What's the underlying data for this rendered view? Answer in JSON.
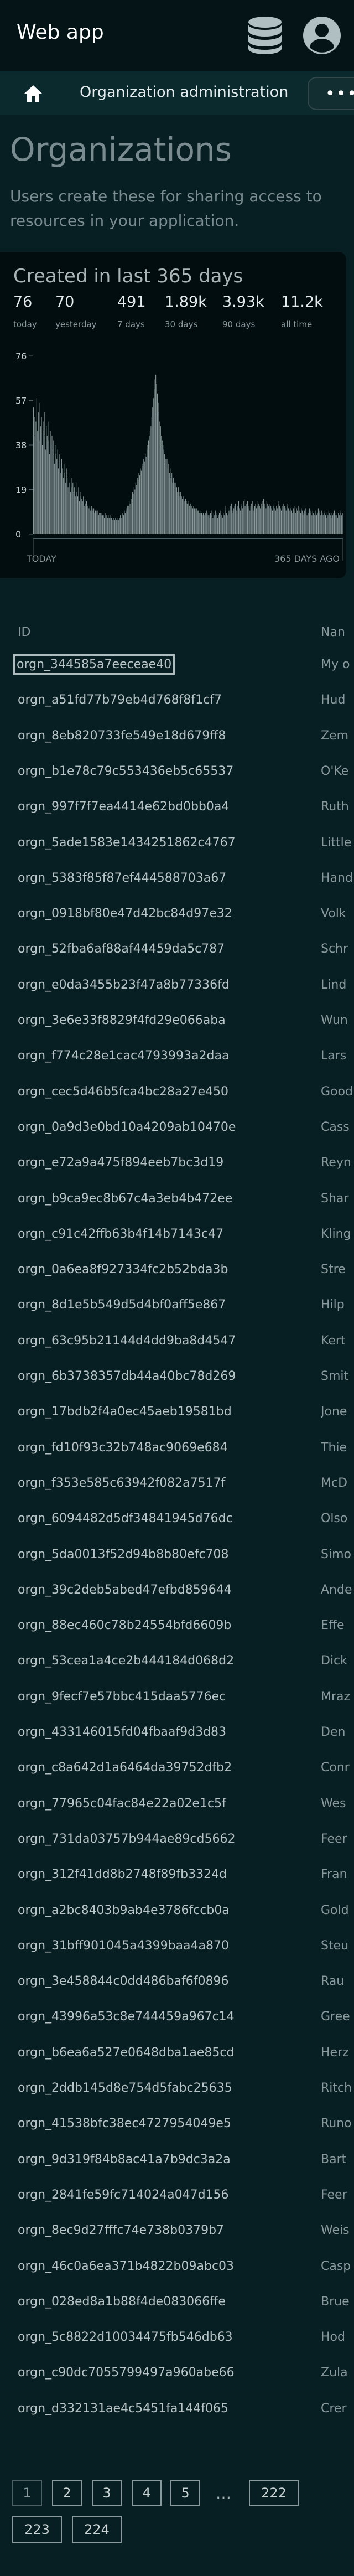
{
  "app": {
    "title": "Web app"
  },
  "nav": {
    "title": "Organization administration",
    "more_label": "•••"
  },
  "page": {
    "title": "Organizations",
    "description": "Users create these for sharing access to resources in your application."
  },
  "stats": {
    "title": "Created in last 365 days",
    "items": [
      {
        "value": "76",
        "label": "today"
      },
      {
        "value": "70",
        "label": "yesterday"
      },
      {
        "value": "491",
        "label": "7 days"
      },
      {
        "value": "1.89k",
        "label": "30 days"
      },
      {
        "value": "3.93k",
        "label": "90 days"
      },
      {
        "value": "11.2k",
        "label": "all time"
      }
    ]
  },
  "chart_data": {
    "type": "bar",
    "title": "Created in last 365 days",
    "y_ticks": [
      "76",
      "57",
      "38",
      "19",
      "0"
    ],
    "x_labels": {
      "left": "TODAY",
      "right": "365 DAYS AGO"
    },
    "ylim": [
      0,
      76
    ],
    "values": [
      54,
      50,
      42,
      48,
      58,
      44,
      52,
      40,
      56,
      46,
      50,
      38,
      48,
      44,
      52,
      36,
      46,
      42,
      40,
      48,
      34,
      44,
      38,
      42,
      36,
      40,
      30,
      38,
      34,
      32,
      36,
      28,
      34,
      30,
      26,
      32,
      28,
      24,
      30,
      26,
      22,
      28,
      24,
      20,
      26,
      22,
      18,
      24,
      20,
      22,
      18,
      20,
      16,
      22,
      18,
      16,
      20,
      14,
      18,
      16,
      15,
      14,
      16,
      12,
      15,
      13,
      14,
      12,
      13,
      11,
      12,
      10,
      12,
      11,
      10,
      11,
      9,
      10,
      10,
      9,
      10,
      8,
      9,
      9,
      8,
      9,
      8,
      8,
      7,
      9,
      8,
      8,
      7,
      8,
      7,
      7,
      8,
      7,
      6,
      7,
      7,
      6,
      7,
      6,
      6,
      7,
      6,
      7,
      8,
      7,
      8,
      9,
      8,
      10,
      9,
      11,
      10,
      12,
      12,
      14,
      13,
      16,
      15,
      18,
      17,
      20,
      19,
      22,
      21,
      24,
      23,
      26,
      25,
      28,
      27,
      30,
      29,
      32,
      31,
      34,
      33,
      36,
      38,
      40,
      42,
      44,
      46,
      50,
      54,
      58,
      62,
      66,
      68,
      64,
      60,
      56,
      52,
      48,
      46,
      42,
      40,
      38,
      36,
      34,
      32,
      30,
      32,
      28,
      30,
      26,
      28,
      24,
      26,
      22,
      24,
      22,
      20,
      22,
      20,
      18,
      20,
      18,
      16,
      18,
      16,
      15,
      16,
      15,
      14,
      15,
      14,
      13,
      14,
      13,
      12,
      13,
      12,
      12,
      11,
      12,
      11,
      11,
      10,
      11,
      10,
      10,
      9,
      10,
      9,
      9,
      8,
      9,
      8,
      8,
      9,
      10,
      9,
      8,
      7,
      8,
      9,
      10,
      8,
      7,
      9,
      8,
      10,
      9,
      8,
      7,
      8,
      9,
      10,
      9,
      8,
      7,
      9,
      8,
      10,
      12,
      9,
      8,
      11,
      10,
      9,
      12,
      13,
      10,
      9,
      11,
      12,
      13,
      10,
      9,
      12,
      14,
      11,
      10,
      13,
      12,
      11,
      14,
      15,
      12,
      11,
      13,
      14,
      12,
      11,
      10,
      12,
      13,
      14,
      11,
      10,
      12,
      13,
      11,
      12,
      14,
      13,
      12,
      11,
      13,
      12,
      14,
      15,
      13,
      12,
      11,
      14,
      13,
      12,
      11,
      13,
      12,
      11,
      10,
      12,
      13,
      11,
      10,
      12,
      11,
      13,
      14,
      12,
      11,
      10,
      12,
      11,
      13,
      12,
      11,
      10,
      12,
      13,
      11,
      10,
      12,
      11,
      10,
      9,
      11,
      12,
      10,
      9,
      11,
      10,
      12,
      11,
      10,
      9,
      11,
      10,
      9,
      8,
      10,
      11,
      9,
      8,
      10,
      9,
      11,
      10,
      9,
      8,
      10,
      9,
      8,
      9,
      10,
      8,
      9,
      11,
      10,
      9,
      8,
      10,
      9,
      8,
      10,
      9,
      8,
      7,
      9,
      8,
      10,
      9,
      8,
      7,
      9,
      8,
      9,
      10,
      8,
      9,
      8,
      7,
      9,
      8,
      10,
      9,
      8,
      9
    ]
  },
  "table": {
    "header_id": "ID",
    "header_name": "Nan",
    "rows": [
      {
        "id": "orgn_344585a7eeceae40",
        "name": "My o"
      },
      {
        "id": "orgn_a51fd77b79eb4d768f8f1cf7",
        "name": "Hud"
      },
      {
        "id": "orgn_8eb820733fe549e18d679ff8",
        "name": "Zem"
      },
      {
        "id": "orgn_b1e78c79c553436eb5c65537",
        "name": "O'Ke"
      },
      {
        "id": "orgn_997f7f7ea4414e62bd0bb0a4",
        "name": "Ruth"
      },
      {
        "id": "orgn_5ade1583e1434251862c4767",
        "name": "Little"
      },
      {
        "id": "orgn_5383f85f87ef444588703a67",
        "name": "Hand"
      },
      {
        "id": "orgn_0918bf80e47d42bc84d97e32",
        "name": "Volk"
      },
      {
        "id": "orgn_52fba6af88af44459da5c787",
        "name": "Schr"
      },
      {
        "id": "orgn_e0da3455b23f47a8b77336fd",
        "name": "Lind"
      },
      {
        "id": "orgn_3e6e33f8829f4fd29e066aba",
        "name": "Wun"
      },
      {
        "id": "orgn_f774c28e1cac4793993a2daa",
        "name": "Lars"
      },
      {
        "id": "orgn_cec5d46b5fca4bc28a27e450",
        "name": "Good"
      },
      {
        "id": "orgn_0a9d3e0bd10a4209ab10470e",
        "name": "Cass"
      },
      {
        "id": "orgn_e72a9a475f894eeb7bc3d19",
        "name": "Reyn"
      },
      {
        "id": "orgn_b9ca9ec8b67c4a3eb4b472ee",
        "name": "Shar"
      },
      {
        "id": "orgn_c91c42ffb63b4f14b7143c47",
        "name": "Kling"
      },
      {
        "id": "orgn_0a6ea8f927334fc2b52bda3b",
        "name": "Stre"
      },
      {
        "id": "orgn_8d1e5b549d5d4bf0aff5e867",
        "name": "Hilp"
      },
      {
        "id": "orgn_63c95b21144d4dd9ba8d4547",
        "name": "Kert"
      },
      {
        "id": "orgn_6b3738357db44a40bc78d269",
        "name": "Smit"
      },
      {
        "id": "orgn_17bdb2f4a0ec45aeb19581bd",
        "name": "Jone"
      },
      {
        "id": "orgn_fd10f93c32b748ac9069e684",
        "name": "Thie"
      },
      {
        "id": "orgn_f353e585c63942f082a7517f",
        "name": "McD"
      },
      {
        "id": "orgn_6094482d5df34841945d76dc",
        "name": "Olso"
      },
      {
        "id": "orgn_5da0013f52d94b8b80efc708",
        "name": "Simo"
      },
      {
        "id": "orgn_39c2deb5abed47efbd859644",
        "name": "Ande"
      },
      {
        "id": "orgn_88ec460c78b24554bfd6609b",
        "name": "Effe"
      },
      {
        "id": "orgn_53cea1a4ce2b444184d068d2",
        "name": "Dick"
      },
      {
        "id": "orgn_9fecf7e57bbc415daa5776ec",
        "name": "Mraz"
      },
      {
        "id": "orgn_433146015fd04fbaaf9d3d83",
        "name": "Den"
      },
      {
        "id": "orgn_c8a642d1a6464da39752dfb2",
        "name": "Conr"
      },
      {
        "id": "orgn_77965c04fac84e22a02e1c5f",
        "name": "Wes"
      },
      {
        "id": "orgn_731da03757b944ae89cd5662",
        "name": "Feer"
      },
      {
        "id": "orgn_312f41dd8b2748f89fb3324d",
        "name": "Fran"
      },
      {
        "id": "orgn_a2bc8403b9ab4e3786fccb0a",
        "name": "Gold"
      },
      {
        "id": "orgn_31bff901045a4399baa4a870",
        "name": "Steu"
      },
      {
        "id": "orgn_3e458844c0dd486baf6f0896",
        "name": "Rau"
      },
      {
        "id": "orgn_43996a53c8e744459a967c14",
        "name": "Gree"
      },
      {
        "id": "orgn_b6ea6a527e0648dba1ae85cd",
        "name": "Herz"
      },
      {
        "id": "orgn_2ddb145d8e754d5fabc25635",
        "name": "Ritch"
      },
      {
        "id": "orgn_41538bfc38ec4727954049e5",
        "name": "Runo"
      },
      {
        "id": "orgn_9d319f84b8ac41a7b9dc3a2a",
        "name": "Bart"
      },
      {
        "id": "orgn_2841fe59fc714024a047d156",
        "name": "Feer"
      },
      {
        "id": "orgn_8ec9d27fffc74e738b0379b7",
        "name": "Weis"
      },
      {
        "id": "orgn_46c0a6ea371b4822b09abc03",
        "name": "Casp"
      },
      {
        "id": "orgn_028ed8a1b88f4de083066ffe",
        "name": "Brue"
      },
      {
        "id": "orgn_5c8822d10034475fb546db63",
        "name": "Hod"
      },
      {
        "id": "orgn_c90dc7055799497a960abe66",
        "name": "Zula"
      },
      {
        "id": "orgn_d332131ae4c5451fa144f065",
        "name": "Crer"
      }
    ]
  },
  "pagination": {
    "pages": [
      "1",
      "2",
      "3",
      "4",
      "5"
    ],
    "ellipsis": "…",
    "last_pages": [
      "222",
      "223",
      "224"
    ],
    "current": "1"
  }
}
